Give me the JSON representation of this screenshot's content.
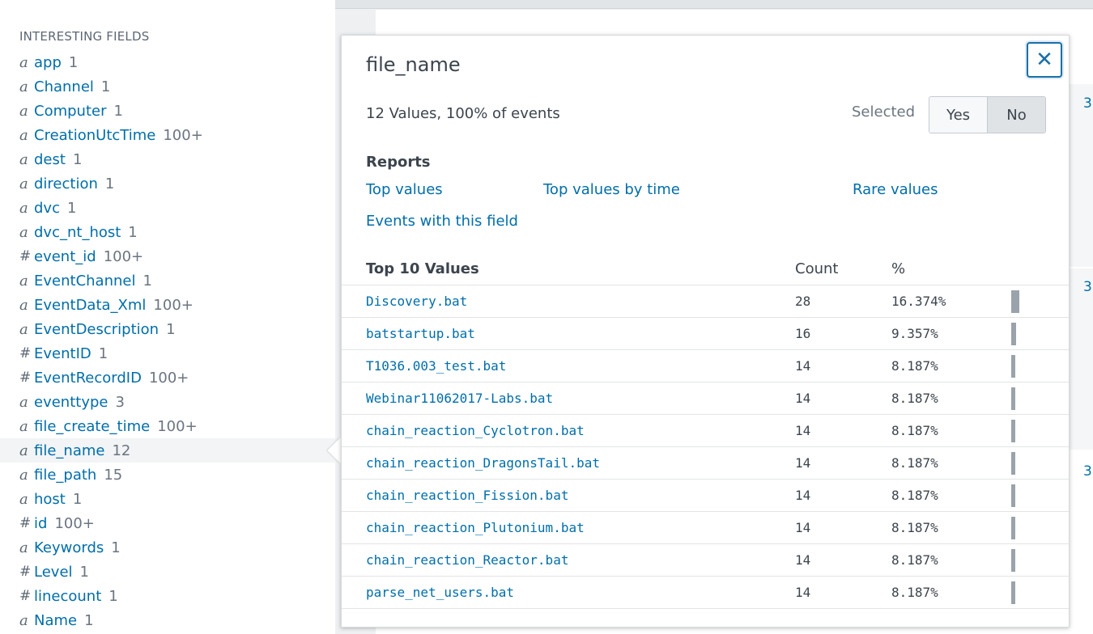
{
  "sidebar": {
    "heading": "INTERESTING FIELDS",
    "fields": [
      {
        "type": "a",
        "name": "app",
        "count": "1"
      },
      {
        "type": "a",
        "name": "Channel",
        "count": "1"
      },
      {
        "type": "a",
        "name": "Computer",
        "count": "1"
      },
      {
        "type": "a",
        "name": "CreationUtcTime",
        "count": "100+"
      },
      {
        "type": "a",
        "name": "dest",
        "count": "1"
      },
      {
        "type": "a",
        "name": "direction",
        "count": "1"
      },
      {
        "type": "a",
        "name": "dvc",
        "count": "1"
      },
      {
        "type": "a",
        "name": "dvc_nt_host",
        "count": "1"
      },
      {
        "type": "#",
        "name": "event_id",
        "count": "100+"
      },
      {
        "type": "a",
        "name": "EventChannel",
        "count": "1"
      },
      {
        "type": "a",
        "name": "EventData_Xml",
        "count": "100+"
      },
      {
        "type": "a",
        "name": "EventDescription",
        "count": "1"
      },
      {
        "type": "#",
        "name": "EventID",
        "count": "1"
      },
      {
        "type": "#",
        "name": "EventRecordID",
        "count": "100+"
      },
      {
        "type": "a",
        "name": "eventtype",
        "count": "3"
      },
      {
        "type": "a",
        "name": "file_create_time",
        "count": "100+"
      },
      {
        "type": "a",
        "name": "file_name",
        "count": "12",
        "selected": true
      },
      {
        "type": "a",
        "name": "file_path",
        "count": "15"
      },
      {
        "type": "a",
        "name": "host",
        "count": "1"
      },
      {
        "type": "#",
        "name": "id",
        "count": "100+"
      },
      {
        "type": "a",
        "name": "Keywords",
        "count": "1"
      },
      {
        "type": "#",
        "name": "Level",
        "count": "1"
      },
      {
        "type": "#",
        "name": "linecount",
        "count": "1"
      },
      {
        "type": "a",
        "name": "Name",
        "count": "1"
      }
    ]
  },
  "background": {
    "event_numbers": [
      "3",
      "3",
      "3"
    ]
  },
  "popover": {
    "title": "file_name",
    "close_label": "✕",
    "summary": "12 Values, 100% of events",
    "selected_label": "Selected",
    "toggle": {
      "yes": "Yes",
      "no": "No",
      "active": "No"
    },
    "reports_title": "Reports",
    "reports": [
      "Top values",
      "Top values by time",
      "Rare values",
      "Events with this field"
    ],
    "table_headers": {
      "value": "Top 10 Values",
      "count": "Count",
      "percent": "%"
    },
    "values": [
      {
        "value": "Discovery.bat",
        "count": "28",
        "percent": "16.374%",
        "bar": 16.374
      },
      {
        "value": "batstartup.bat",
        "count": "16",
        "percent": "9.357%",
        "bar": 9.357
      },
      {
        "value": "T1036.003_test.bat",
        "count": "14",
        "percent": "8.187%",
        "bar": 8.187
      },
      {
        "value": "Webinar11062017-Labs.bat",
        "count": "14",
        "percent": "8.187%",
        "bar": 8.187
      },
      {
        "value": "chain_reaction_Cyclotron.bat",
        "count": "14",
        "percent": "8.187%",
        "bar": 8.187
      },
      {
        "value": "chain_reaction_DragonsTail.bat",
        "count": "14",
        "percent": "8.187%",
        "bar": 8.187
      },
      {
        "value": "chain_reaction_Fission.bat",
        "count": "14",
        "percent": "8.187%",
        "bar": 8.187
      },
      {
        "value": "chain_reaction_Plutonium.bat",
        "count": "14",
        "percent": "8.187%",
        "bar": 8.187
      },
      {
        "value": "chain_reaction_Reactor.bat",
        "count": "14",
        "percent": "8.187%",
        "bar": 8.187
      },
      {
        "value": "parse_net_users.bat",
        "count": "14",
        "percent": "8.187%",
        "bar": 8.187
      }
    ]
  }
}
